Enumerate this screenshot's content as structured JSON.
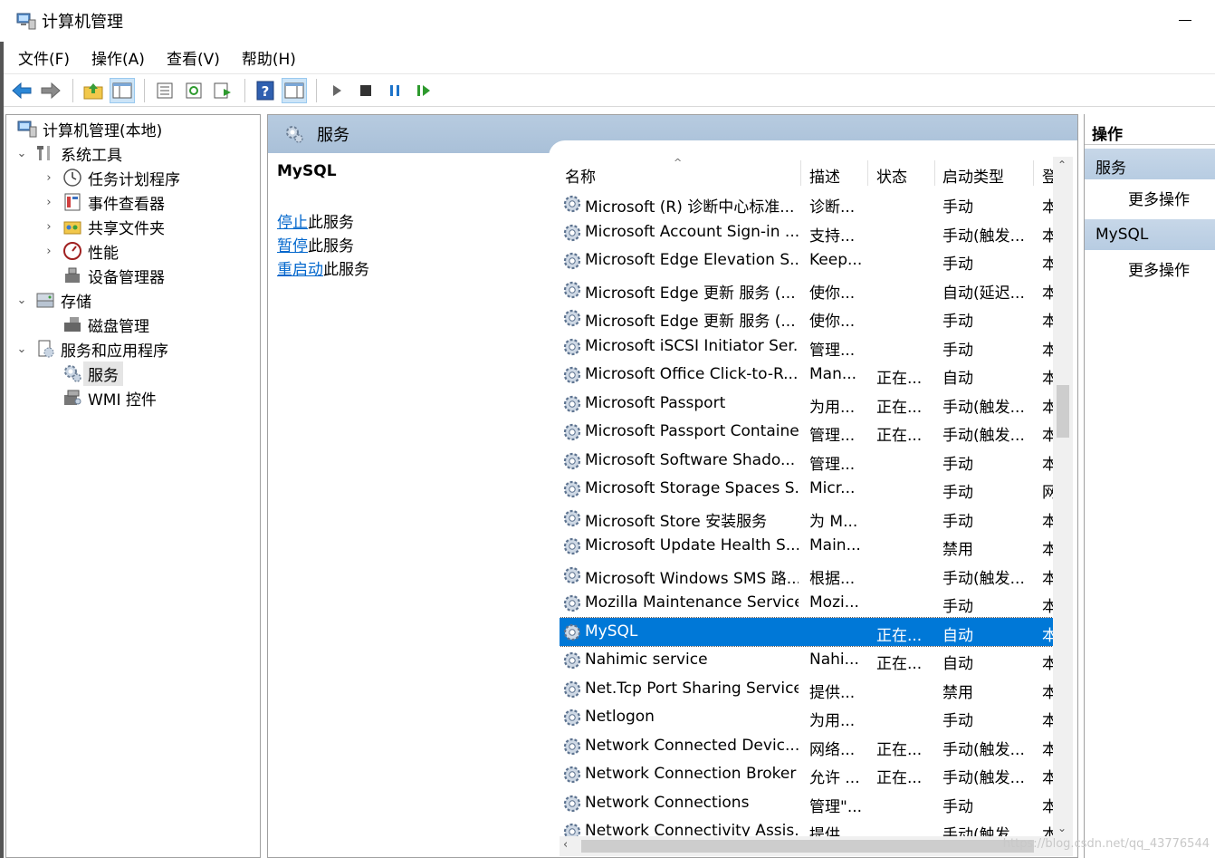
{
  "window": {
    "title": "计算机管理"
  },
  "menu": [
    "文件(F)",
    "操作(A)",
    "查看(V)",
    "帮助(H)"
  ],
  "tree": [
    {
      "label": "计算机管理(本地)",
      "level": 0,
      "chevron": "",
      "icon": "computer-management-icon"
    },
    {
      "label": "系统工具",
      "level": 1,
      "chevron": "⌄",
      "icon": "system-tools-icon"
    },
    {
      "label": "任务计划程序",
      "level": 2,
      "chevron": "›",
      "icon": "task-scheduler-icon"
    },
    {
      "label": "事件查看器",
      "level": 2,
      "chevron": "›",
      "icon": "event-viewer-icon"
    },
    {
      "label": "共享文件夹",
      "level": 2,
      "chevron": "›",
      "icon": "shared-folders-icon"
    },
    {
      "label": "性能",
      "level": 2,
      "chevron": "›",
      "icon": "performance-icon"
    },
    {
      "label": "设备管理器",
      "level": 2,
      "chevron": "",
      "icon": "device-manager-icon"
    },
    {
      "label": "存储",
      "level": 1,
      "chevron": "⌄",
      "icon": "storage-icon"
    },
    {
      "label": "磁盘管理",
      "level": 2,
      "chevron": "",
      "icon": "disk-management-icon"
    },
    {
      "label": "服务和应用程序",
      "level": 1,
      "chevron": "⌄",
      "icon": "services-apps-icon"
    },
    {
      "label": "服务",
      "level": 2,
      "chevron": "",
      "icon": "services-icon",
      "selected": true
    },
    {
      "label": "WMI 控件",
      "level": 2,
      "chevron": "",
      "icon": "wmi-icon"
    }
  ],
  "middle": {
    "header_title": "服务",
    "selected_service": "MySQL",
    "actions": [
      {
        "link": "停止",
        "rest": "此服务"
      },
      {
        "link": "暂停",
        "rest": "此服务"
      },
      {
        "link": "重启动",
        "rest": "此服务"
      }
    ]
  },
  "columns": [
    "名称",
    "描述",
    "状态",
    "启动类型",
    "登"
  ],
  "services": [
    {
      "name": "Microsoft (R) 诊断中心标准...",
      "desc": "诊断...",
      "status": "",
      "startup": "手动",
      "logon": "本"
    },
    {
      "name": "Microsoft Account Sign-in ...",
      "desc": "支持...",
      "status": "",
      "startup": "手动(触发...",
      "logon": "本"
    },
    {
      "name": "Microsoft Edge Elevation S...",
      "desc": "Keep...",
      "status": "",
      "startup": "手动",
      "logon": "本"
    },
    {
      "name": "Microsoft Edge 更新 服务 (...",
      "desc": "使你...",
      "status": "",
      "startup": "自动(延迟...",
      "logon": "本"
    },
    {
      "name": "Microsoft Edge 更新 服务 (...",
      "desc": "使你...",
      "status": "",
      "startup": "手动",
      "logon": "本"
    },
    {
      "name": "Microsoft iSCSI Initiator Ser...",
      "desc": "管理...",
      "status": "",
      "startup": "手动",
      "logon": "本"
    },
    {
      "name": "Microsoft Office Click-to-R...",
      "desc": "Man...",
      "status": "正在...",
      "startup": "自动",
      "logon": "本"
    },
    {
      "name": "Microsoft Passport",
      "desc": "为用...",
      "status": "正在...",
      "startup": "手动(触发...",
      "logon": "本"
    },
    {
      "name": "Microsoft Passport Container",
      "desc": "管理...",
      "status": "正在...",
      "startup": "手动(触发...",
      "logon": "本"
    },
    {
      "name": "Microsoft Software Shado...",
      "desc": "管理...",
      "status": "",
      "startup": "手动",
      "logon": "本"
    },
    {
      "name": "Microsoft Storage Spaces S...",
      "desc": "Micr...",
      "status": "",
      "startup": "手动",
      "logon": "网"
    },
    {
      "name": "Microsoft Store 安装服务",
      "desc": "为 M...",
      "status": "",
      "startup": "手动",
      "logon": "本"
    },
    {
      "name": "Microsoft Update Health S...",
      "desc": "Main...",
      "status": "",
      "startup": "禁用",
      "logon": "本"
    },
    {
      "name": "Microsoft Windows SMS 路...",
      "desc": "根据...",
      "status": "",
      "startup": "手动(触发...",
      "logon": "本"
    },
    {
      "name": "Mozilla Maintenance Service",
      "desc": "Mozi...",
      "status": "",
      "startup": "手动",
      "logon": "本"
    },
    {
      "name": "MySQL",
      "desc": "",
      "status": "正在...",
      "startup": "自动",
      "logon": "本",
      "selected": true
    },
    {
      "name": "Nahimic service",
      "desc": "Nahi...",
      "status": "正在...",
      "startup": "自动",
      "logon": "本"
    },
    {
      "name": "Net.Tcp Port Sharing Service",
      "desc": "提供...",
      "status": "",
      "startup": "禁用",
      "logon": "本"
    },
    {
      "name": "Netlogon",
      "desc": "为用...",
      "status": "",
      "startup": "手动",
      "logon": "本"
    },
    {
      "name": "Network Connected Devic...",
      "desc": "网络...",
      "status": "正在...",
      "startup": "手动(触发...",
      "logon": "本"
    },
    {
      "name": "Network Connection Broker",
      "desc": "允许 ...",
      "status": "正在...",
      "startup": "手动(触发...",
      "logon": "本"
    },
    {
      "name": "Network Connections",
      "desc": "管理\"...",
      "status": "",
      "startup": "手动",
      "logon": "本"
    },
    {
      "name": "Network Connectivity Assis...",
      "desc": "提供...",
      "status": "",
      "startup": "手动(触发...",
      "logon": "本"
    }
  ],
  "actions_pane": {
    "title": "操作",
    "groups": [
      {
        "name": "服务",
        "item": "更多操作"
      },
      {
        "name": "MySQL",
        "item": "更多操作"
      }
    ]
  },
  "watermark": "https://blog.csdn.net/qq_43776544"
}
